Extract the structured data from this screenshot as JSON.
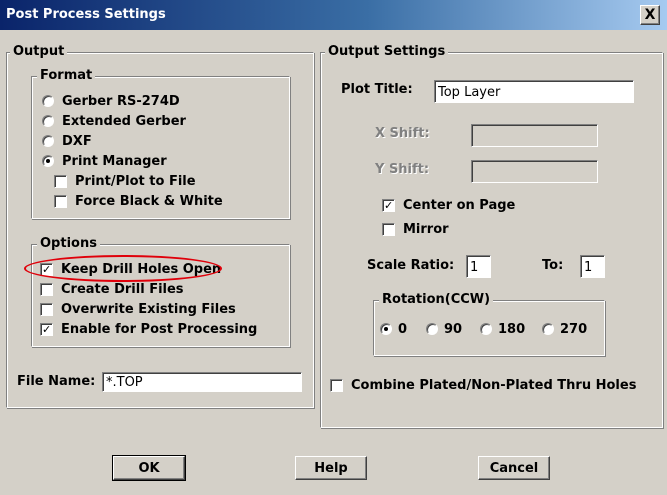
{
  "window": {
    "title": "Post Process Settings",
    "close_label": "X"
  },
  "output": {
    "legend": "Output",
    "format": {
      "legend": "Format",
      "options": [
        {
          "label": "Gerber RS-274D",
          "selected": false
        },
        {
          "label": "Extended Gerber",
          "selected": false
        },
        {
          "label": "DXF",
          "selected": false
        },
        {
          "label": "Print Manager",
          "selected": true
        }
      ],
      "suboptions": [
        {
          "label": "Print/Plot to File",
          "checked": false
        },
        {
          "label": "Force Black & White",
          "checked": false
        }
      ]
    },
    "options": {
      "legend": "Options",
      "items": [
        {
          "label": "Keep Drill Holes Open",
          "checked": true,
          "highlighted": true
        },
        {
          "label": "Create Drill Files",
          "checked": false
        },
        {
          "label": "Overwrite Existing Files",
          "checked": false
        },
        {
          "label": "Enable for Post Processing",
          "checked": true
        }
      ]
    },
    "file_name": {
      "label": "File Name:",
      "value": "*.TOP"
    }
  },
  "output_settings": {
    "legend": "Output Settings",
    "plot_title": {
      "label": "Plot Title:",
      "value": "Top Layer"
    },
    "x_shift": {
      "label": "X Shift:",
      "value": ""
    },
    "y_shift": {
      "label": "Y Shift:",
      "value": ""
    },
    "center_on_page": {
      "label": "Center on Page",
      "checked": true
    },
    "mirror": {
      "label": "Mirror",
      "checked": false
    },
    "scale_ratio": {
      "label": "Scale Ratio:",
      "value": "1"
    },
    "to": {
      "label": "To:",
      "value": "1"
    },
    "rotation": {
      "legend": "Rotation(CCW)",
      "options": [
        {
          "label": "0",
          "selected": true
        },
        {
          "label": "90",
          "selected": false
        },
        {
          "label": "180",
          "selected": false
        },
        {
          "label": "270",
          "selected": false
        }
      ]
    },
    "combine": {
      "label": "Combine Plated/Non-Plated Thru Holes",
      "checked": false
    }
  },
  "buttons": {
    "ok": "OK",
    "help": "Help",
    "cancel": "Cancel"
  },
  "colors": {
    "title_bar": "#0a246a",
    "face": "#d4d0c8",
    "highlight_ellipse": "#e0000a"
  }
}
